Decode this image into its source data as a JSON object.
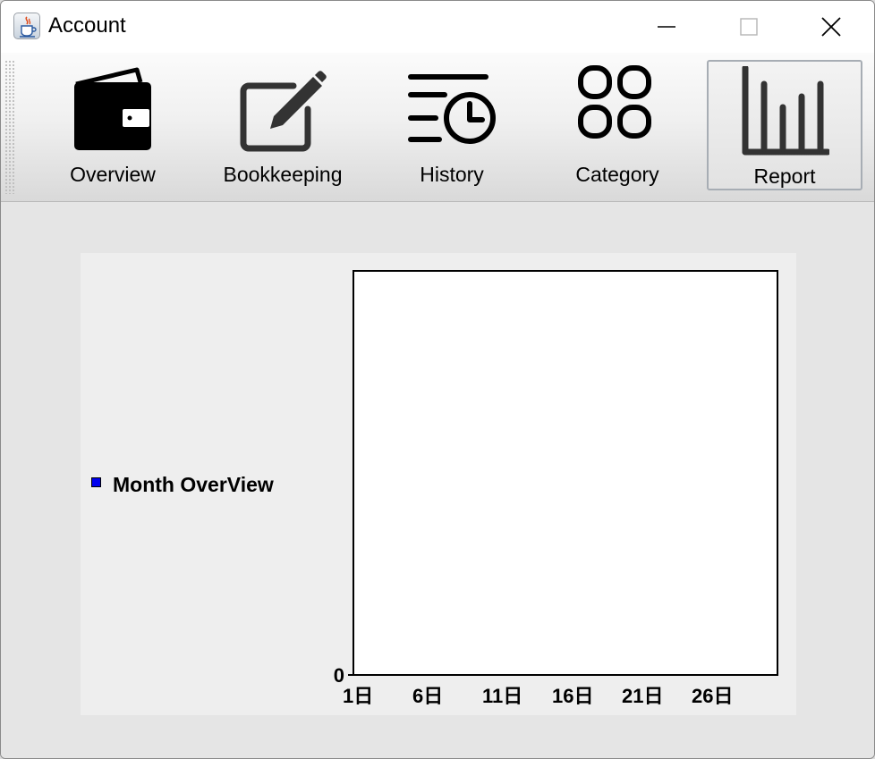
{
  "window": {
    "title": "Account",
    "app_icon": "java-cup-icon",
    "controls": [
      "minimize-icon",
      "maximize-icon",
      "close-icon"
    ]
  },
  "toolbar": {
    "items": [
      {
        "label": "Overview",
        "icon": "wallet-icon",
        "selected": false
      },
      {
        "label": "Bookkeeping",
        "icon": "edit-icon",
        "selected": false
      },
      {
        "label": "History",
        "icon": "history-clock-icon",
        "selected": false
      },
      {
        "label": "Category",
        "icon": "category-grid-icon",
        "selected": false
      },
      {
        "label": "Report",
        "icon": "bar-chart-icon",
        "selected": true
      }
    ]
  },
  "chart_data": {
    "type": "bar",
    "title": "",
    "xlabel": "",
    "ylabel": "",
    "legend_placement": "left",
    "series": [
      {
        "name": "Month OverView",
        "color": "#0000ee",
        "values": []
      }
    ],
    "x_tick_labels": [
      "1日",
      "6日",
      "11日",
      "16日",
      "21日",
      "26日"
    ],
    "y_tick_labels": [
      "0"
    ],
    "grid": false
  },
  "colors": {
    "legend_series": "#0000ee",
    "plot_background": "#ffffff",
    "panel_background": "#eeeeee"
  }
}
